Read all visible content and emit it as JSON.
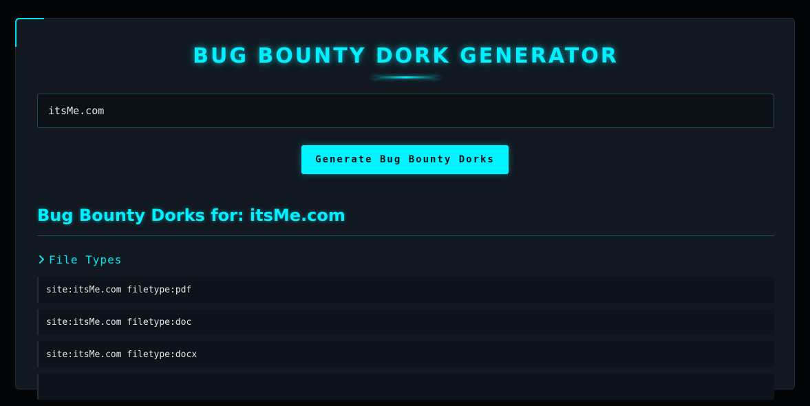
{
  "app": {
    "title": "BUG BOUNTY DORK GENERATOR"
  },
  "search": {
    "value": "itsMe.com"
  },
  "actions": {
    "generate_label": "Generate Bug Bounty Dorks"
  },
  "results": {
    "heading": "Bug Bounty Dorks for: itsMe.com",
    "categories": [
      {
        "label": "File Types",
        "icon": "chevron-right-icon",
        "dorks": [
          "site:itsMe.com filetype:pdf",
          "site:itsMe.com filetype:doc",
          "site:itsMe.com filetype:docx",
          ""
        ]
      }
    ]
  },
  "colors": {
    "accent": "#00f0ff",
    "background": "#040506",
    "panel": "#121820",
    "button": "#00f5ff"
  }
}
